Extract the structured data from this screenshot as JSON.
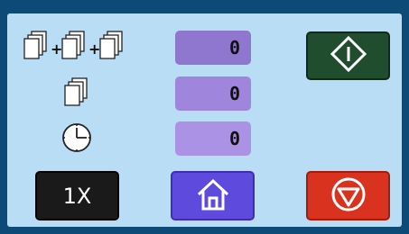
{
  "counters": {
    "sets": "0",
    "sheets": "0",
    "time": "0"
  },
  "rows": {
    "sets_icon": "stacked-sets-icon",
    "sheets_icon": "sheet-stack-icon",
    "time_icon": "clock-icon"
  },
  "buttons": {
    "start_icon": "start-diamond-icon",
    "speed_label": "1X",
    "home_icon": "home-icon",
    "stop_icon": "stop-icon"
  },
  "colors": {
    "frame": "#0d4a78",
    "screen": "#b9ddf5",
    "counter_sets": "#8f76cf",
    "counter_sheets": "#9f85dc",
    "counter_time": "#ac92e4",
    "start_button": "#1f4d2d",
    "speed_button": "#1a1a1a",
    "home_button": "#5e4bdd",
    "stop_button": "#d9321e"
  }
}
